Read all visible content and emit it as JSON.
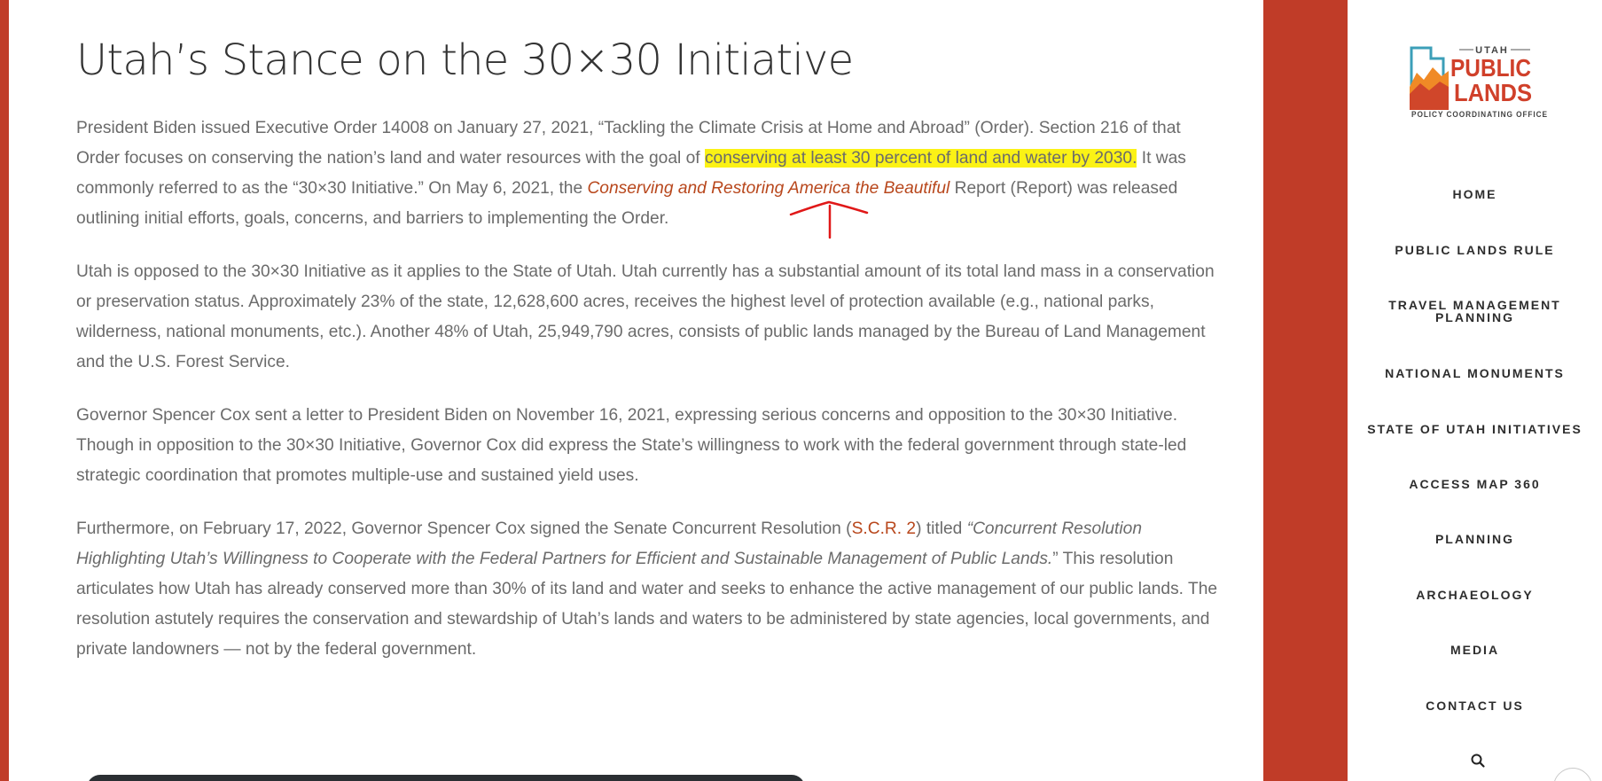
{
  "article": {
    "title": "Utah’s Stance on the 30×30 Initiative",
    "p1": {
      "part1": "President Biden issued Executive Order 14008 on January 27, 2021, “Tackling the Climate Crisis at Home and Abroad” (Order). Section 216 of that Order focuses on conserving the nation’s land and water resources with the goal of ",
      "highlight": "conserving at least 30 percent of land and water by 2030.",
      "part2": " It was commonly referred to as the “30×30 Initiative.” On May 6, 2021, the ",
      "link": "Conserving and Restoring America the Beautiful",
      "part3": " Report (Report) was released outlining initial efforts, goals, concerns, and barriers to implementing the Order."
    },
    "p2": "Utah is opposed to the 30×30 Initiative as it applies to the State of Utah. Utah currently has a substantial amount of its total land mass in a conservation or preservation status. Approximately 23% of the state, 12,628,600 acres, receives the highest level of protection available (e.g., national parks, wilderness, national monuments, etc.). Another 48% of Utah, 25,949,790 acres, consists of public lands managed by the Bureau of Land Management and the U.S. Forest Service.",
    "p3": "Governor Spencer Cox sent a letter to President Biden on November 16, 2021, expressing serious concerns and opposition to the 30×30 Initiative. Though in opposition to the 30×30 Initiative, Governor Cox did express the State’s willingness to work with the federal government through state-led strategic coordination that promotes multiple-use and sustained yield uses.",
    "p4": {
      "part1": "Furthermore, on February 17, 2022, Governor Spencer Cox signed the Senate Concurrent Resolution (",
      "link": "S.C.R. 2",
      "part2": ") titled ",
      "italic": "“Concurrent Resolution Highlighting Utah’s Willingness to Cooperate with the Federal Partners for Efficient and Sustainable Management of Public Lands.",
      "part3": "” This resolution articulates how Utah has already conserved more than 30% of its land and water and seeks to enhance the active management of our public lands. The resolution astutely requires the conservation and stewardship of Utah’s lands and waters to be administered by state agencies, local governments, and private landowners — not by the federal government."
    }
  },
  "logo": {
    "top": "UTAH",
    "line1": "PUBLIC",
    "line2": "LANDS",
    "bottom": "POLICY COORDINATING OFFICE"
  },
  "nav": {
    "home": "HOME",
    "public_lands_rule": "PUBLIC LANDS RULE",
    "travel_1": "TRAVEL MANAGEMENT",
    "travel_2": "PLANNING",
    "national_monuments": "NATIONAL MONUMENTS",
    "state_initiatives": "STATE OF UTAH INITIATIVES",
    "access_map": "ACCESS MAP 360",
    "planning": "PLANNING",
    "archaeology": "ARCHAEOLOGY",
    "media": "MEDIA",
    "contact": "CONTACT US"
  },
  "colors": {
    "brand_red": "#c03c28",
    "link": "#b8471c",
    "highlight": "#fbf215",
    "body_text": "#6b6b6b"
  },
  "icons": {
    "search": "search-icon",
    "scroll_top": "scroll-top-icon"
  }
}
